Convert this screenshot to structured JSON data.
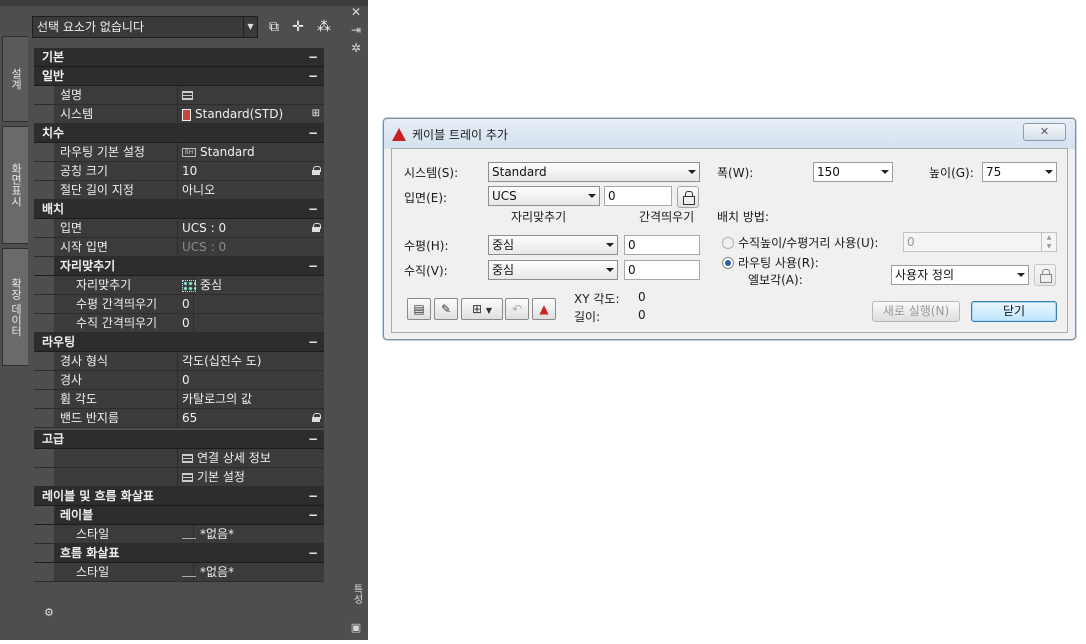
{
  "palette": {
    "selector_value": "선택 요소가 없습니다",
    "side_tabs": [
      "설계",
      "화면표시",
      "확장 데이터"
    ],
    "right_bar_label": "특성",
    "top_icons": [
      "quick-select-icon",
      "select-objects-icon",
      "add-icon"
    ],
    "categories": [
      {
        "label": "기본",
        "rows": []
      },
      {
        "label": "일반",
        "rows": [
          {
            "name": "설명",
            "value": "",
            "icon": "table-icon"
          },
          {
            "name": "시스템",
            "value": "Standard(STD)",
            "icon": "system-icon"
          }
        ]
      },
      {
        "label": "치수",
        "rows": [
          {
            "name": "라우팅 기본 설정",
            "value": "Standard",
            "icon": "routing-icon"
          },
          {
            "name": "공칭 크기",
            "value": "10",
            "lock": true
          },
          {
            "name": "절단 길이 지정",
            "value": "아니오",
            "star": true
          }
        ]
      },
      {
        "label": "배치",
        "rows": [
          {
            "name": "입면",
            "value": "UCS : 0",
            "lock": true
          },
          {
            "name": "시작 입면",
            "value": "UCS : 0",
            "dim": true
          }
        ],
        "subcategory": {
          "label": "자리맞추기",
          "rows": [
            {
              "name": "자리맞추기",
              "value": "중심",
              "star": true,
              "icon": "justification-icon"
            },
            {
              "name": "수평 간격띄우기",
              "value": "0",
              "star": true
            },
            {
              "name": "수직 간격띄우기",
              "value": "0",
              "star": true
            }
          ]
        }
      },
      {
        "label": "라우팅",
        "rows": [
          {
            "name": "경사 형식",
            "value": "각도(십진수 도)"
          },
          {
            "name": "경사",
            "value": "0"
          },
          {
            "name": "휨 각도",
            "value": "카탈로그의 값",
            "star": true
          },
          {
            "name": "밴드 반지름",
            "value": "65",
            "star": true,
            "lock": true
          }
        ]
      },
      {
        "label": "고급",
        "rows": [
          {
            "name": "",
            "value": "연결 상세 정보",
            "icon": "table-icon"
          },
          {
            "name": "",
            "value": "기본 설정",
            "star": true,
            "icon": "table-icon"
          }
        ]
      },
      {
        "label": "레이블 및 흐름 화살표",
        "rows": [],
        "subcategories": [
          {
            "label": "레이블",
            "rows": [
              {
                "name": "스타일",
                "value": "*없음*",
                "star": true
              }
            ]
          },
          {
            "label": "흐름 화살표",
            "rows": [
              {
                "name": "스타일",
                "value": "*없음*",
                "star": true
              }
            ]
          }
        ]
      }
    ],
    "collapse_symbol": "−",
    "close_glyph": "✕"
  },
  "dialog": {
    "title": "케이블 트레이 추가",
    "close_glyph": "✕",
    "system_label": "시스템(S):",
    "system_value": "Standard",
    "elevation_label": "입면(E):",
    "elevation_ucs": "UCS",
    "elevation_value": "0",
    "width_label": "폭(W):",
    "width_value": "150",
    "height_label": "높이(G):",
    "height_value": "75",
    "justification_header": "자리맞추기",
    "offset_header": "간격띄우기",
    "horizontal_label": "수평(H):",
    "horizontal_just": "중심",
    "horizontal_offset": "0",
    "vertical_label": "수직(V):",
    "vertical_just": "중심",
    "vertical_offset": "0",
    "placement_label": "배치 방법:",
    "radio_vertical_label": "수직높이/수평거리 사용(U):",
    "radio_vertical_value": "0",
    "radio_routing_label": "라우팅 사용(R):",
    "elbow_label": "엘보각(A):",
    "elbow_value": "사용자 정의",
    "xy_angle_label": "XY 각도:",
    "xy_angle_value": "0",
    "length_label": "길이:",
    "length_value": "0",
    "new_run_label": "새로 실행(N)",
    "close_label": "닫기"
  }
}
